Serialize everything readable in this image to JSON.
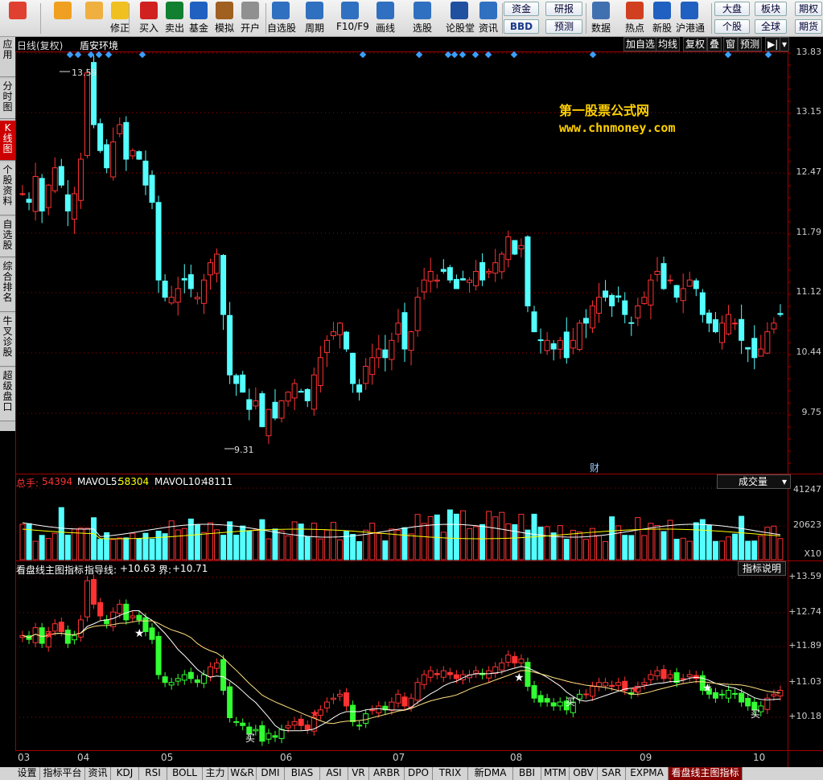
{
  "toolbar": {
    "buttons": [
      {
        "label": "",
        "icon": "windows-logo-icon"
      },
      {
        "label": "",
        "icon": "back-arrow-icon"
      },
      {
        "label": "",
        "icon": "up-down-arrow-icon"
      },
      {
        "label": "修正",
        "icon": "refresh-icon"
      },
      {
        "label": "买入",
        "icon": "buy-icon"
      },
      {
        "label": "卖出",
        "icon": "sell-icon"
      },
      {
        "label": "基金",
        "icon": "fund-icon"
      },
      {
        "label": "模拟",
        "icon": "gavel-icon"
      },
      {
        "label": "开户",
        "icon": "lock-icon"
      },
      {
        "label": "自选股",
        "icon": "star-folder-icon"
      },
      {
        "label": "周期",
        "icon": "clock-icon"
      },
      {
        "label": "F10/F9",
        "icon": "f10-icon"
      },
      {
        "label": "画线",
        "icon": "pen-icon"
      },
      {
        "label": "选股",
        "icon": "screen-icon"
      },
      {
        "label": "论股堂",
        "icon": "forum-icon"
      },
      {
        "label": "资讯",
        "icon": "news-icon"
      },
      {
        "label": "数据",
        "icon": "pe-icon"
      },
      {
        "label": "热点",
        "icon": "hot-icon"
      },
      {
        "label": "新股",
        "icon": "new-stock-icon"
      },
      {
        "label": "沪港通",
        "icon": "hk-connect-icon"
      }
    ],
    "pills": [
      "资金",
      "BBD",
      "研报",
      "预测",
      "大盘",
      "板块",
      "个股",
      "全球",
      "期权",
      "期货"
    ]
  },
  "sidetabs": [
    "应用",
    "分时图",
    "K线图",
    "个股资料",
    "自选股",
    "综合排名",
    "牛叉诊股",
    "超级盘口"
  ],
  "main": {
    "title": "日线(复权)",
    "stock_name": "盾安环境",
    "top_buttons": [
      "加自选",
      "均线",
      "复权",
      "叠",
      "窗",
      "预测"
    ],
    "watermark_line1": "第一股票公式网",
    "watermark_line2": "www.chnmoney.com",
    "high_label": "13.59",
    "low_label": "9.31",
    "fin_marker": "财",
    "price_axis": [
      "13.83",
      "13.15",
      "12.47",
      "11.79",
      "11.12",
      "10.44",
      "9.75"
    ]
  },
  "volume": {
    "label_total": "总手:",
    "total_value": "54394",
    "label_ma5": "MAVOL5:",
    "ma5_value": "58304",
    "label_ma10": "MAVOL10:",
    "ma10_value": "48111",
    "selector": "成交量",
    "axis": [
      "41247",
      "20623",
      "X10"
    ]
  },
  "indicator": {
    "name": "看盘线主图指标",
    "label_guide": "指导线:",
    "guide_value": "+10.63",
    "label_bound": "界:",
    "bound_value": "+10.71",
    "help_button": "指标说明",
    "axis": [
      "+13.59",
      "+12.74",
      "+11.89",
      "+11.03",
      "+10.18"
    ],
    "buy_marker": "买"
  },
  "months": [
    "03",
    "04",
    "05",
    "06",
    "07",
    "08",
    "09",
    "10"
  ],
  "bottom_tabs": [
    "设置",
    "指标平台",
    "资讯",
    "KDJ",
    "RSI",
    "BOLL",
    "主力",
    "W&R",
    "DMI",
    "BIAS",
    "ASI",
    "VR",
    "ARBR",
    "DPO",
    "TRIX",
    "新DMA",
    "BBI",
    "MTM",
    "OBV",
    "SAR",
    "EXPMA",
    "看盘线主图指标"
  ],
  "colors": {
    "up": "#ff3232",
    "down": "#54ffff",
    "grid": "#a00000",
    "accent": "#ffd000",
    "buy_green": "#33ff33"
  },
  "chart_data": {
    "type": "candlestick",
    "ylim": [
      9.31,
      13.83
    ],
    "series": [
      {
        "values": [
          12.2,
          12.1,
          12.4,
          12.0,
          12.3,
          12.5,
          12.3,
          12.0,
          12.2,
          12.6,
          13.6,
          13.0,
          12.7,
          12.5,
          12.8,
          13.0,
          12.6,
          12.7,
          12.6,
          12.3,
          12.1,
          11.2,
          11.0,
          11.0,
          11.1,
          11.2,
          11.1,
          11.0,
          11.2,
          11.4,
          11.5,
          10.8,
          10.1,
          10.0,
          9.9,
          9.7,
          9.8,
          9.5,
          9.7,
          9.6,
          9.8,
          9.9,
          10.0,
          9.9,
          9.8,
          10.1,
          10.3,
          10.5,
          10.6,
          10.7,
          10.4,
          10.0,
          9.9,
          10.2,
          10.3,
          10.4,
          10.3,
          10.5,
          10.7,
          10.4,
          10.6,
          11.0,
          11.2,
          11.3,
          11.2,
          11.3,
          11.2,
          11.1,
          11.2,
          11.2,
          11.3,
          11.2,
          11.3,
          11.4,
          11.5,
          11.7,
          11.5,
          11.6,
          10.9,
          10.6,
          10.5,
          10.5,
          10.4,
          10.5,
          10.3,
          10.5,
          10.7,
          10.7,
          10.9,
          11.0,
          11.0,
          10.9,
          11.0,
          10.8,
          10.7,
          10.9,
          11.0,
          11.2,
          11.3,
          11.1,
          11.2,
          11.0,
          11.1,
          11.2,
          11.1,
          10.8,
          10.7,
          10.6,
          10.7,
          10.8,
          10.7,
          10.5,
          10.4,
          10.3,
          10.4,
          10.6,
          10.7,
          10.8
        ]
      }
    ]
  }
}
